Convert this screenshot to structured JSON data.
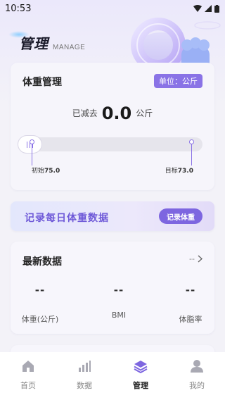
{
  "status_bar": {
    "time": "10:53"
  },
  "header": {
    "title": "管理",
    "subtitle": "MANAGE"
  },
  "weight_card": {
    "title": "体重管理",
    "unit_badge": "单位：公斤",
    "lost_label": "已减去",
    "lost_value": "0.0",
    "lost_unit": "公斤",
    "progress_fraction": 0,
    "start_label": "初始",
    "start_value": "75.0",
    "goal_label": "目标",
    "goal_value": "73.0"
  },
  "record_banner": {
    "title": "记录每日体重数据",
    "button_label": "记录体重"
  },
  "latest_card": {
    "title": "最新数据",
    "more_text": "--",
    "metrics": [
      {
        "value": "--",
        "label": "体重(公斤)"
      },
      {
        "value": "--",
        "label": "BMI"
      },
      {
        "value": "--",
        "label": "体脂率"
      }
    ]
  },
  "tabbar": {
    "tabs": [
      {
        "label": "首页",
        "icon": "home-icon",
        "active": false
      },
      {
        "label": "数据",
        "icon": "bar-chart-icon",
        "active": false
      },
      {
        "label": "管理",
        "icon": "layers-icon",
        "active": true
      },
      {
        "label": "我的",
        "icon": "user-icon",
        "active": false
      }
    ]
  },
  "colors": {
    "accent": "#8a73e6",
    "background": "#f3f2f8",
    "inactive_tab": "#a9a9b3"
  }
}
